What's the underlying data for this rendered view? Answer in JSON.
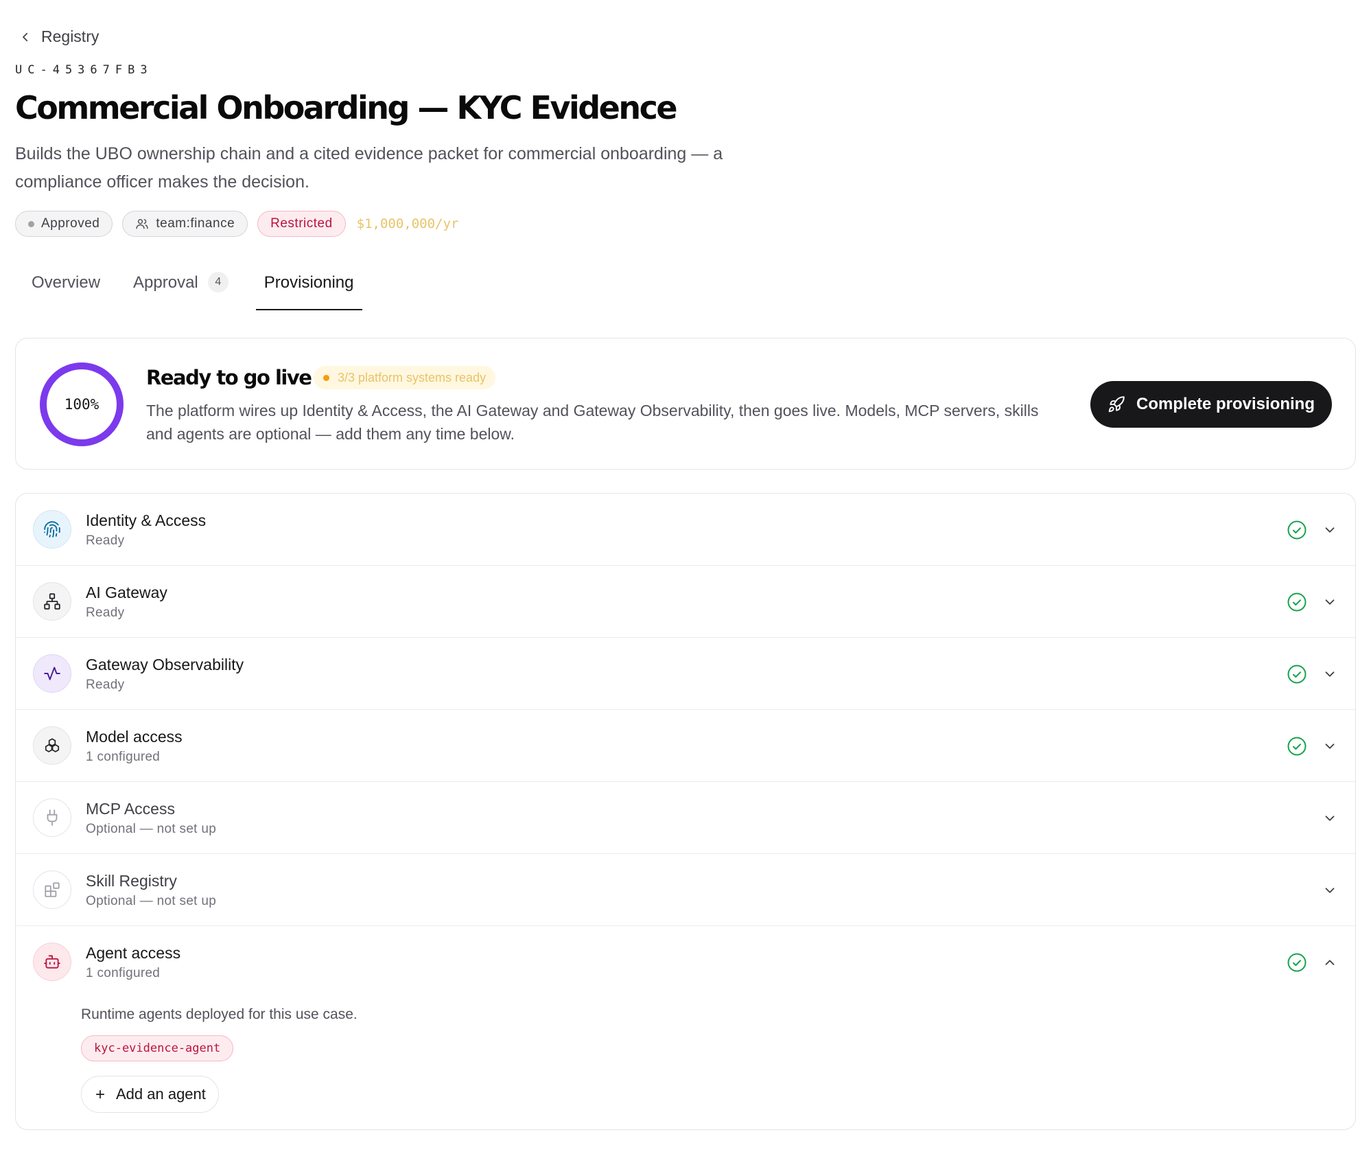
{
  "nav": {
    "back_label": "Registry"
  },
  "header": {
    "code": "UC-45367FB3",
    "title": "Commercial Onboarding — KYC Evidence",
    "description": "Builds the UBO ownership chain and a cited evidence packet for commercial onboarding — a compliance officer makes the decision.",
    "badges": {
      "status": "Approved",
      "team": "team:finance",
      "restriction": "Restricted",
      "budget": "$1,000,000/yr"
    }
  },
  "tabs": [
    {
      "label": "Overview"
    },
    {
      "label": "Approval",
      "count": "4"
    },
    {
      "label": "Provisioning",
      "active": true
    }
  ],
  "ready": {
    "progress_percent": 100,
    "progress_label": "100%",
    "title": "Ready to go live",
    "systems_label": "3/3 platform systems ready",
    "description": "The platform wires up Identity & Access, the AI Gateway and Gateway Observability, then goes live. Models, MCP servers, skills and agents are optional — add them any time below.",
    "cta_label": "Complete provisioning"
  },
  "systems": [
    {
      "name": "Identity & Access",
      "status": "Ready",
      "icon": "fingerprint-icon",
      "checked": true
    },
    {
      "name": "AI Gateway",
      "status": "Ready",
      "icon": "network-icon",
      "checked": true
    },
    {
      "name": "Gateway Observability",
      "status": "Ready",
      "icon": "activity-icon",
      "checked": true
    },
    {
      "name": "Model access",
      "status": "1 configured",
      "icon": "cubes-icon",
      "checked": true
    },
    {
      "name": "MCP Access",
      "status": "Optional — not set up",
      "icon": "plug-icon",
      "checked": false
    },
    {
      "name": "Skill Registry",
      "status": "Optional — not set up",
      "icon": "blocks-icon",
      "checked": false
    },
    {
      "name": "Agent access",
      "status": "1 configured",
      "icon": "bot-icon",
      "checked": true,
      "expanded": true
    }
  ],
  "agent_section": {
    "description": "Runtime agents deployed for this use case.",
    "agents": [
      "kyc-evidence-agent"
    ],
    "add_label": "Add an agent"
  },
  "colors": {
    "accent_ring": "#7c3aed",
    "ready_check": "#16a34a",
    "restricted": "#be123c",
    "budget": "#e8c468",
    "cta_bg": "#18181b"
  }
}
